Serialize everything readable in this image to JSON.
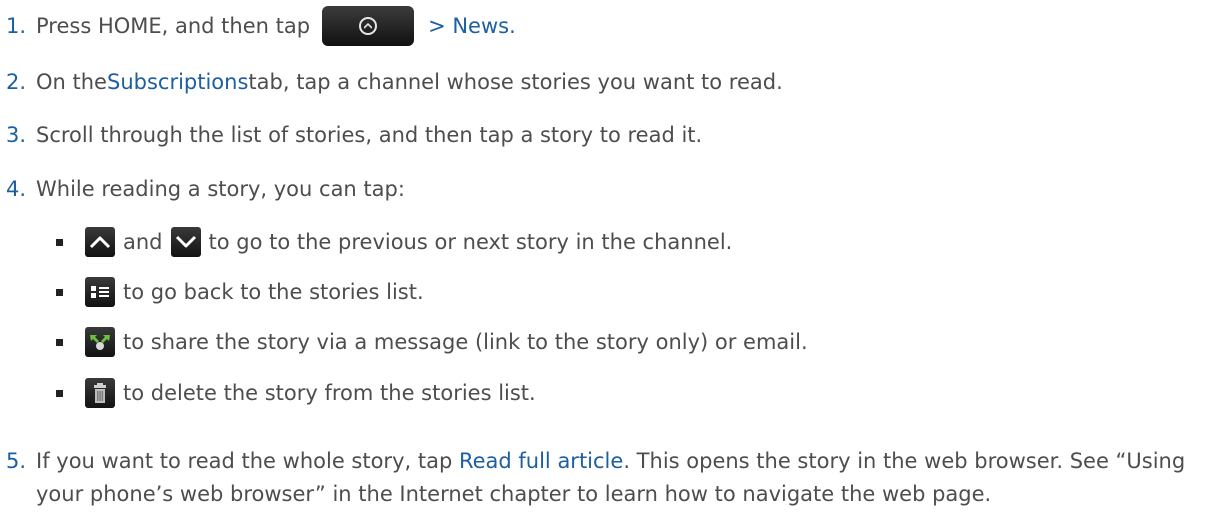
{
  "steps": [
    {
      "number": "1.",
      "before": "Press HOME, and then tap",
      "icon": "home-button-icon",
      "after": "> News."
    },
    {
      "number": "2.",
      "before": "On the ",
      "keyword": "Subscriptions",
      "after": " tab, tap a channel whose stories you want to read."
    },
    {
      "number": "3.",
      "text": "Scroll through the list of stories, and then tap a story to read it."
    },
    {
      "number": "4.",
      "text": "While reading a story, you can tap:",
      "bullets": [
        {
          "icons": [
            "up-arrow-icon",
            "down-arrow-icon"
          ],
          "joiner": "and",
          "text": "to go to the previous or next story in the channel."
        },
        {
          "icons": [
            "stories-list-icon"
          ],
          "text": "to go back to the stories list."
        },
        {
          "icons": [
            "share-icon"
          ],
          "text": "to share the story via a message (link to the story only) or email."
        },
        {
          "icons": [
            "trash-icon"
          ],
          "text": "to delete the story from the stories list."
        }
      ]
    },
    {
      "number": "5.",
      "before": "If you want to read the whole story, tap ",
      "keyword": "Read full article",
      "after": ". This opens the story in the web browser. See “Using your phone’s web browser” in the Internet chapter to learn how to navigate the web page."
    }
  ],
  "colors": {
    "text": "#4d4d4d",
    "accent": "#1d5fa0",
    "icon_bg": "#1a1a1a"
  }
}
